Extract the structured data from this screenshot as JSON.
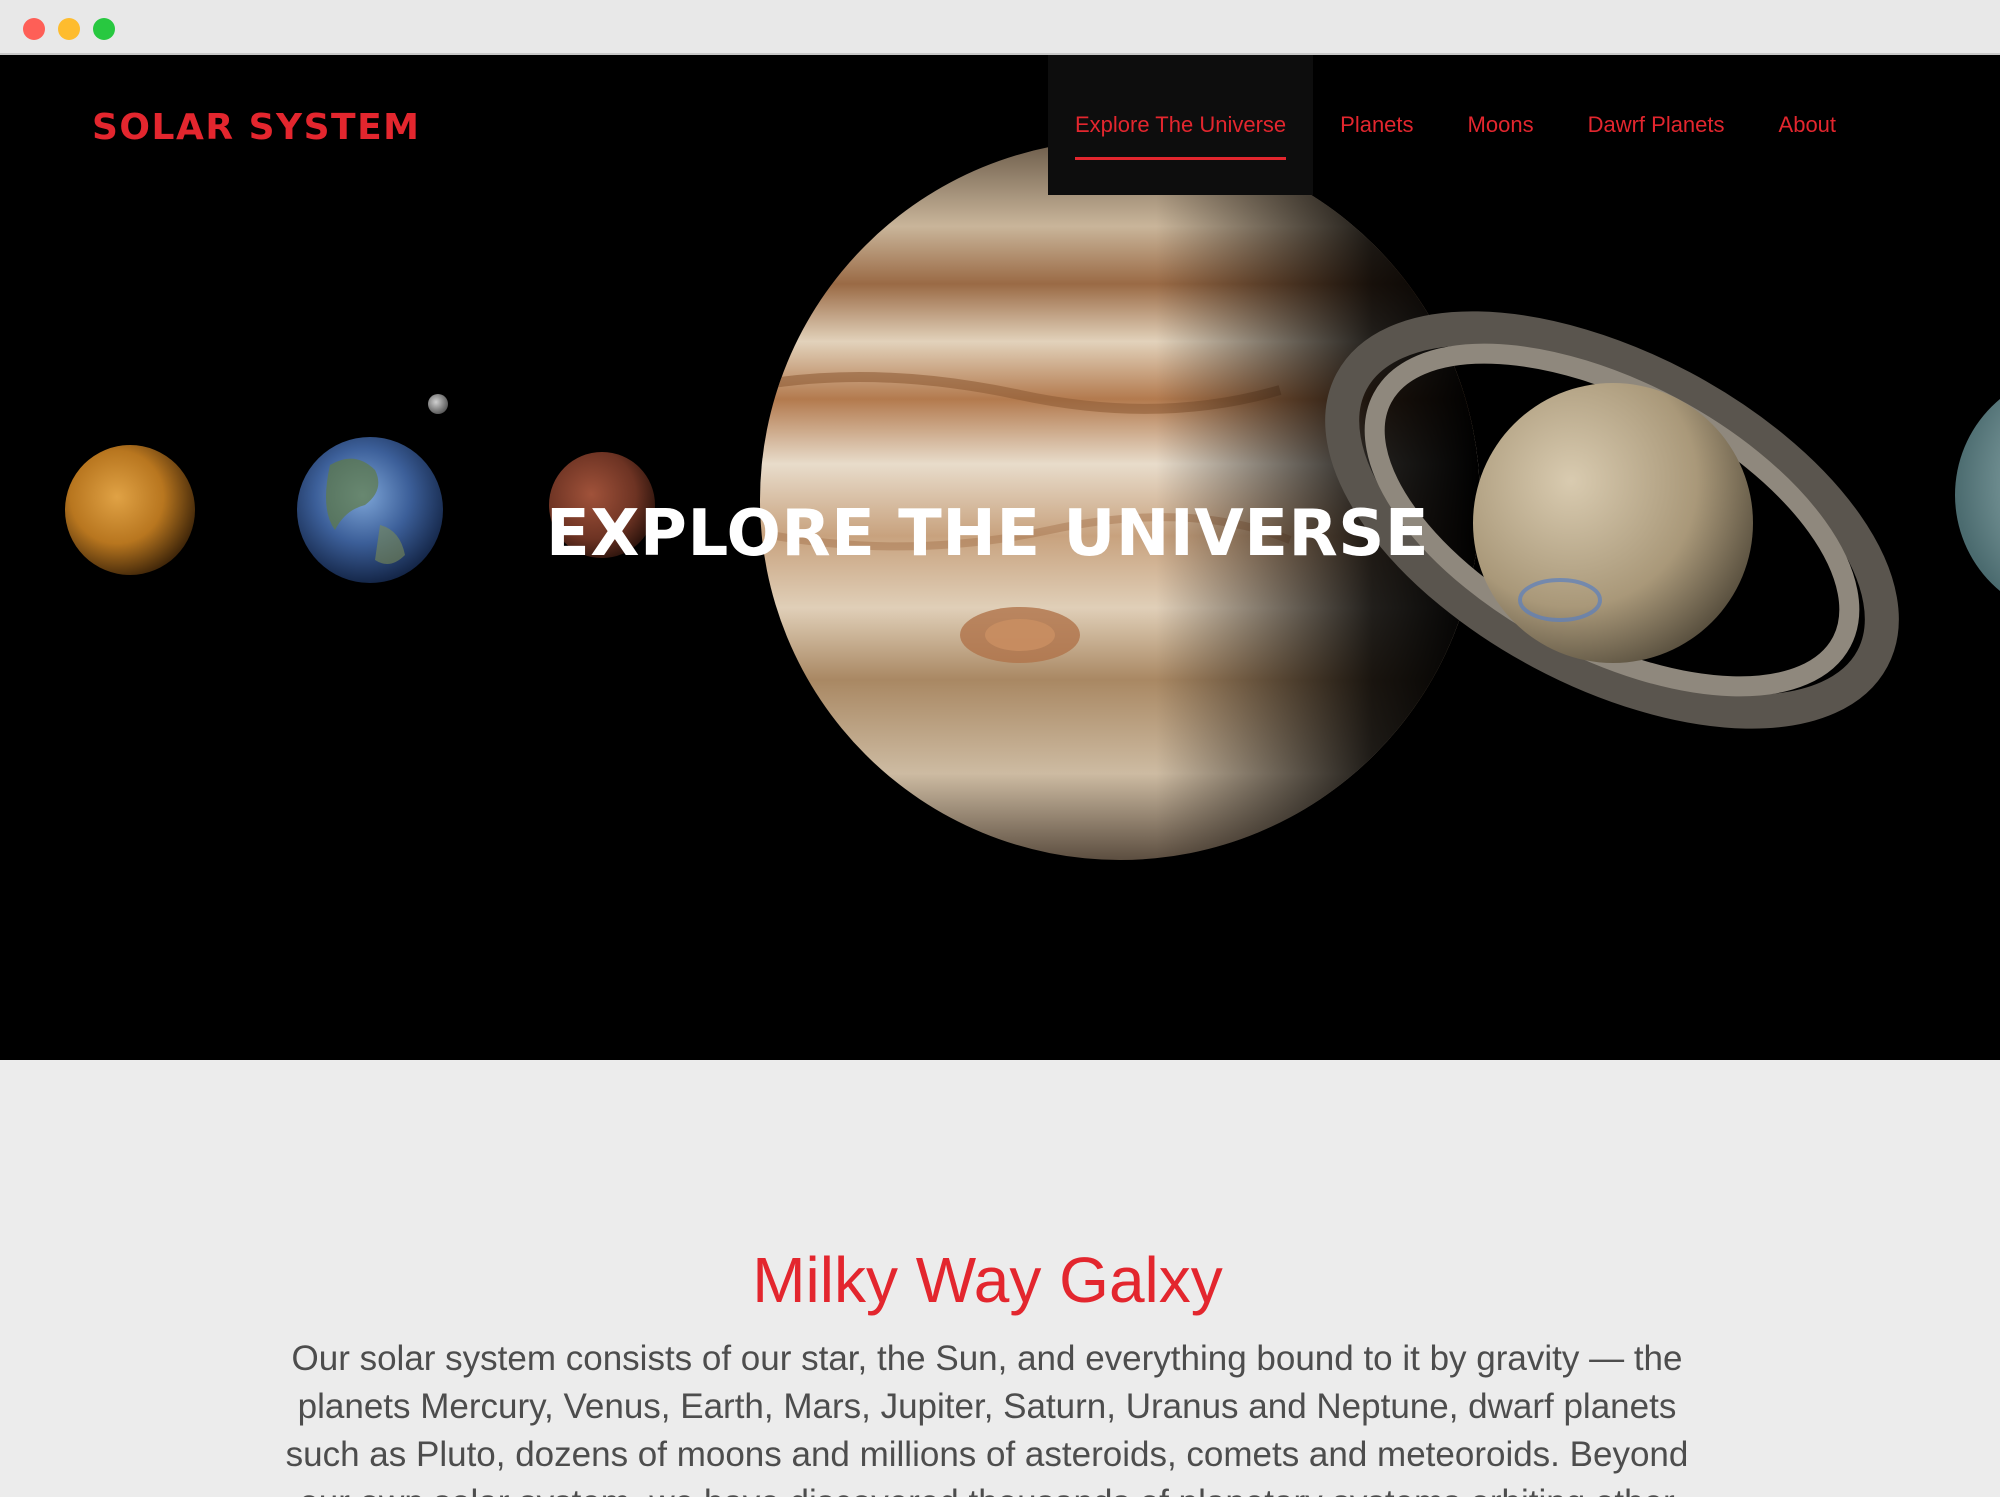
{
  "window": {
    "controls": [
      "close",
      "minimize",
      "zoom"
    ]
  },
  "header": {
    "brand": "SOLAR SYSTEM",
    "nav": [
      {
        "label": "Explore The Universe",
        "active": true
      },
      {
        "label": "Planets",
        "active": false
      },
      {
        "label": "Moons",
        "active": false
      },
      {
        "label": "Dawrf Planets",
        "active": false
      },
      {
        "label": "About",
        "active": false
      }
    ]
  },
  "hero": {
    "title": "EXPLORE THE UNIVERSE",
    "image_content": [
      "venus",
      "earth",
      "moon",
      "mars",
      "jupiter",
      "saturn",
      "uranus"
    ]
  },
  "main": {
    "heading": "Milky Way Galxy",
    "body": "Our solar system consists of our star, the Sun, and everything bound to it by gravity — the planets Mercury, Venus, Earth, Mars, Jupiter, Saturn, Uranus and Neptune, dwarf planets such as Pluto, dozens of moons and millions of asteroids, comets and meteoroids. Beyond our own solar system, we have discovered thousands of planetary systems orbiting other"
  },
  "colors": {
    "accent": "#e3262e",
    "hero_bg": "#000000",
    "content_bg": "#ececec",
    "body_text": "#4d4d4d"
  }
}
